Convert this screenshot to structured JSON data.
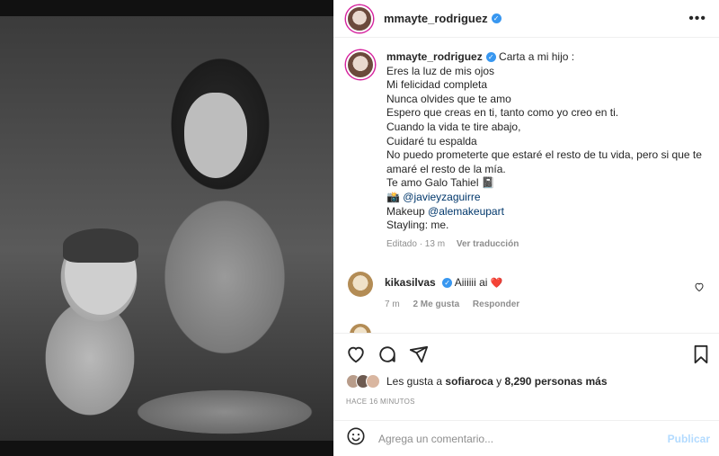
{
  "post": {
    "username": "mmayte_rodriguez",
    "more_icon": "more-dots-icon"
  },
  "caption": {
    "username": "mmayte_rodriguez",
    "lines": [
      "Carta a mi hijo :",
      "Eres la luz de mis ojos",
      "Mi felicidad completa",
      "Nunca olvides que te amo",
      "Espero que creas en ti, tanto como yo creo en ti.",
      "Cuando la vida te tire abajo,",
      "Cuidaré tu espalda",
      "No puedo prometerte que estaré el resto de tu vida, pero si que te amaré el resto de la mía.",
      "Te amo Galo Tahiel 📓"
    ],
    "photo_credit_prefix": "📸",
    "photo_credit": "@javieyzaguirre",
    "makeup_label": "Makeup",
    "makeup_mention": "@alemakeupart",
    "styling": "Stayling: me.",
    "edited": "Editado · 13 m",
    "see_translation": "Ver traducción"
  },
  "comment": {
    "username": "kikasilvas",
    "text": "Aiiiiii ai",
    "heart": "❤️",
    "time": "7 m",
    "likes": "2 Me gusta",
    "reply": "Responder"
  },
  "likes": {
    "prefix": "Les gusta a",
    "user": "sofiaroca",
    "conj": "y",
    "count": "8,290 personas más"
  },
  "time_ago": "HACE 16 MINUTOS",
  "comment_input": {
    "placeholder": "Agrega un comentario...",
    "publish": "Publicar"
  },
  "colors": {
    "verified": "#3897f0",
    "mention": "#00376b",
    "heart": "#ed4956",
    "publish_disabled": "#b3dbff",
    "muted": "#8e8e8e"
  }
}
